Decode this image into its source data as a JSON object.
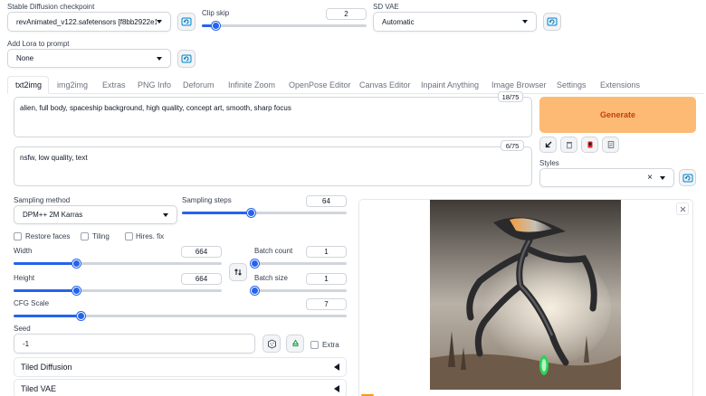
{
  "header": {
    "checkpoint_label": "Stable Diffusion checkpoint",
    "checkpoint_value": "revAnimated_v122.safetensors [f8bb2922e1]",
    "clip_skip_label": "Clip skip",
    "clip_skip_value": "2",
    "clip_skip_fraction": 0.08,
    "vae_label": "SD VAE",
    "vae_value": "Automatic",
    "lora_label": "Add Lora to prompt",
    "lora_value": "None"
  },
  "tabs": [
    {
      "label": "txt2img",
      "active": true
    },
    {
      "label": "img2img"
    },
    {
      "label": "Extras"
    },
    {
      "label": "PNG Info"
    },
    {
      "label": "Deforum"
    },
    {
      "label": "Infinite Zoom"
    },
    {
      "label": "OpenPose Editor"
    },
    {
      "label": "Canvas Editor"
    },
    {
      "label": "Inpaint Anything"
    },
    {
      "label": "Image Browser"
    },
    {
      "label": "Settings"
    },
    {
      "label": "Extensions"
    }
  ],
  "prompt": {
    "text": "alien, full body, spaceship background, high quality, concept art, smooth, sharp focus",
    "token_count": "18/75"
  },
  "negative_prompt": {
    "text": "nsfw, low quality, text",
    "token_count": "6/75"
  },
  "generate_label": "Generate",
  "styles": {
    "label": "Styles",
    "clear_glyph": "×"
  },
  "sampling": {
    "method_label": "Sampling method",
    "method_value": "DPM++ 2M Karras",
    "steps_label": "Sampling steps",
    "steps_value": "64",
    "steps_fraction": 0.42
  },
  "options": {
    "restore_faces": "Restore faces",
    "tiling": "Tiling",
    "hires_fix": "Hires. fix"
  },
  "size": {
    "width_label": "Width",
    "width_value": "664",
    "width_fraction": 0.3,
    "height_label": "Height",
    "height_value": "664",
    "height_fraction": 0.3,
    "batch_count_label": "Batch count",
    "batch_count_value": "1",
    "batch_count_fraction": 0.0,
    "batch_size_label": "Batch size",
    "batch_size_value": "1",
    "batch_size_fraction": 0.0
  },
  "cfg": {
    "label": "CFG Scale",
    "value": "7",
    "fraction": 0.2
  },
  "seed": {
    "label": "Seed",
    "value": "-1",
    "extra_label": "Extra"
  },
  "accordions": {
    "tiled_diffusion": "Tiled Diffusion",
    "tiled_vae": "Tiled VAE"
  },
  "colors": {
    "accent": "#2563eb",
    "generate_bg": "#fdba74",
    "generate_text": "#c2410c"
  }
}
